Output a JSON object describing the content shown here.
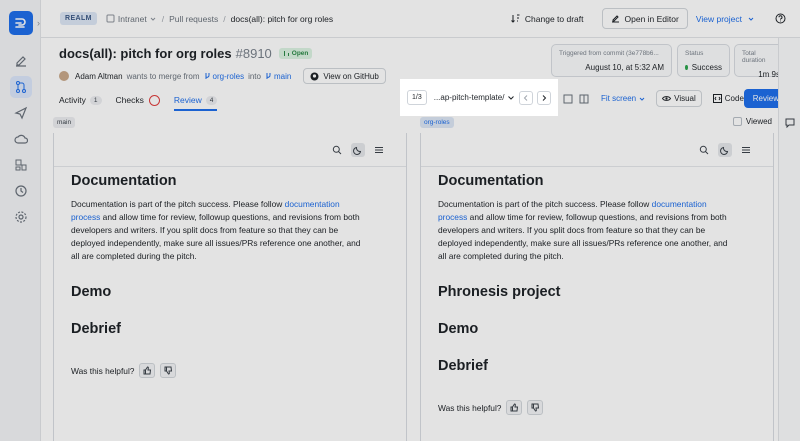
{
  "topbar": {
    "realm": "REALM",
    "breadcrumbs": [
      "Intranet",
      "Pull requests",
      "docs(all): pitch for org roles"
    ],
    "change_to_draft": "Change to draft",
    "open_in_editor": "Open in Editor",
    "view_project": "View project"
  },
  "pr": {
    "title": "docs(all): pitch for org roles",
    "number": "#8910",
    "status_badge": "Open",
    "author": "Adam Altman",
    "wants_to_merge": "wants to merge from",
    "source_branch": "org-roles",
    "into": "into",
    "target_branch": "main",
    "view_on_github": "View on GitHub"
  },
  "cards": {
    "commit_label": "Triggered from commit (3e778b6...",
    "commit_value": "August 10, at 5:32 AM",
    "status_label": "Status",
    "status_value": "Success",
    "duration_label": "Total duration",
    "duration_value": "1m 9s"
  },
  "tabs": [
    {
      "label": "Activity",
      "count": "1"
    },
    {
      "label": "Checks"
    },
    {
      "label": "Review",
      "count": "4"
    }
  ],
  "file_nav": {
    "page": "1/3",
    "file_name": "...ap-pitch-template/"
  },
  "view_controls": {
    "fit": "Fit screen",
    "visual": "Visual",
    "code": "Code",
    "review": "Review",
    "viewed": "Viewed"
  },
  "left_pane": {
    "branch": "main",
    "heading": "Documentation",
    "para_pre": "Documentation is part of the pitch success. Please follow ",
    "para_link": "documentation process",
    "para_post": " and allow time for review, followup questions, and revisions from both developers and writers. If you split docs from feature so that they can be deployed independently, make sure all issues/PRs reference one another, and all are completed during the pitch.",
    "sections": [
      "Demo",
      "Debrief"
    ],
    "helpful": "Was this helpful?"
  },
  "right_pane": {
    "branch": "org-roles",
    "heading": "Documentation",
    "para_pre": "Documentation is part of the pitch success. Please follow ",
    "para_link": "documentation process",
    "para_post": " and allow time for review, followup questions, and revisions from both developers and writers. If you split docs from feature so that they can be deployed independently, make sure all issues/PRs reference one another, and all are completed during the pitch.",
    "sections": [
      "Phronesis project",
      "Demo",
      "Debrief"
    ],
    "helpful": "Was this helpful?"
  },
  "colors": {
    "accent": "#1f6feb",
    "success": "#2da44e",
    "checks_ring": "#e03e3e"
  }
}
